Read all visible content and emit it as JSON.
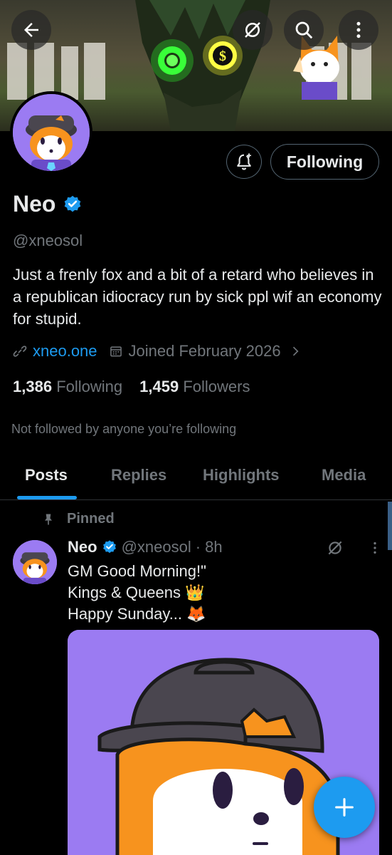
{
  "profile": {
    "name": "Neo",
    "handle": "@xneosol",
    "bio": "Just a frenly fox and a bit of a retard who believes in a republican idiocracy run by sick ppl wif an economy for stupid.",
    "website": "xneo.one",
    "joined": "Joined February 2026",
    "following_count": "1,386",
    "following_label": "Following",
    "followers_count": "1,459",
    "followers_label": "Followers",
    "not_followed": "Not followed by anyone you’re following",
    "follow_button_label": "Following"
  },
  "tabs": [
    {
      "label": "Posts",
      "active": true
    },
    {
      "label": "Replies",
      "active": false
    },
    {
      "label": "Highlights",
      "active": false
    },
    {
      "label": "Media",
      "active": false
    }
  ],
  "post": {
    "pinned_label": "Pinned",
    "author_name": "Neo",
    "author_handle": "@xneosol",
    "time": "· 8h",
    "lines": [
      "GM Good Morning!\"",
      "Kings & Queens 👑",
      "Happy Sunday... 🦊"
    ]
  },
  "icons": {
    "back": "arrow-left-icon",
    "grok": "grok-icon",
    "search": "search-icon",
    "more": "more-vertical-icon",
    "bell": "bell-plus-icon",
    "verified": "verified-badge-icon",
    "link": "link-icon",
    "calendar": "calendar-icon",
    "chevron": "chevron-right-icon",
    "pin": "pin-icon",
    "compose": "plus-icon"
  },
  "colors": {
    "accent": "#1d9bf0",
    "background": "#000000",
    "muted": "#71767b",
    "avatar_bg": "#9b7bf2"
  }
}
